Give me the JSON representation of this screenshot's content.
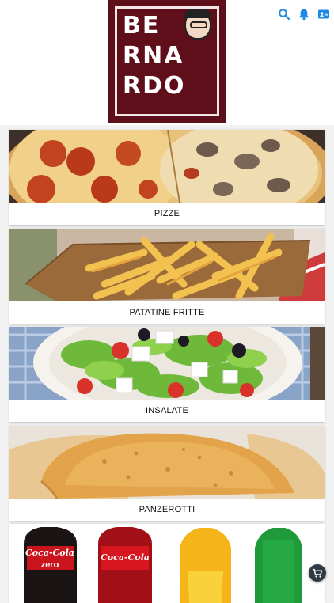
{
  "header": {
    "logo_lines": [
      "BE",
      "RNA",
      "RDO"
    ],
    "logo_alt": "BERNARDO",
    "icons": [
      "search-icon",
      "bell-icon",
      "contact-card-icon"
    ],
    "accent": "#1e88e5"
  },
  "categories": [
    {
      "label": "PIZZE"
    },
    {
      "label": "PATATINE FRITTE"
    },
    {
      "label": "INSALATE"
    },
    {
      "label": "PANZEROTTI"
    }
  ],
  "drinks_card": {
    "brands": [
      "Coca-Cola",
      "Coca-Cola",
      "zero"
    ]
  },
  "cart_button": {
    "icon": "cart-icon"
  }
}
